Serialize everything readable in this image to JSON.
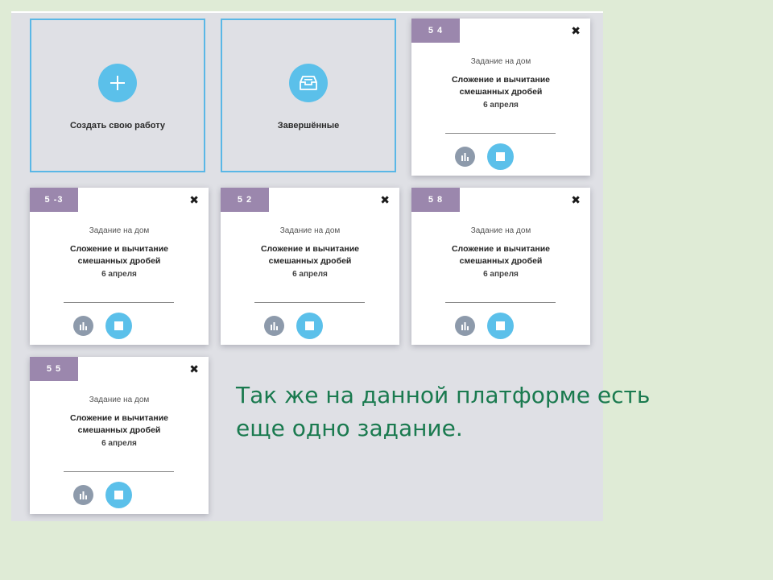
{
  "tiles": {
    "create": {
      "label": "Создать свою работу",
      "icon": "plus-icon"
    },
    "completed": {
      "label": "Завершённые",
      "icon": "archive-box-icon"
    }
  },
  "cards": [
    {
      "badge": "5 4",
      "type": "Задание на дом",
      "title": "Сложение и вычитание смешанных дробей",
      "date": "6 апреля"
    },
    {
      "badge": "5 -3",
      "type": "Задание на дом",
      "title": "Сложение и вычитание смешанных дробей",
      "date": "6 апреля"
    },
    {
      "badge": "5 2",
      "type": "Задание на дом",
      "title": "Сложение и вычитание смешанных дробей",
      "date": "6 апреля"
    },
    {
      "badge": "5 8",
      "type": "Задание на дом",
      "title": "Сложение и вычитание смешанных дробей",
      "date": "6 апреля"
    },
    {
      "badge": "5 5",
      "type": "Задание на дом",
      "title": "Сложение и вычитание смешанных дробей",
      "date": "6 апреля"
    }
  ],
  "card_close_glyph": "✖",
  "caption": "Так же на данной платформе есть еще одно задание.",
  "colors": {
    "slide_background": "#dfebd6",
    "panel_background": "#dfe0e5",
    "accent_blue": "#5bc0ea",
    "badge_purple": "#9b87ad",
    "stats_gray": "#8d9aab",
    "caption_green": "#1a7a4f"
  }
}
